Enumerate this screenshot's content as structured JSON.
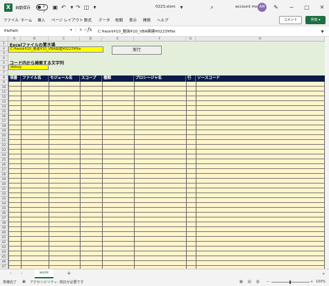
{
  "titlebar": {
    "autosave_label": "自動保存",
    "autosave_state": "オフ",
    "file_title": "0223.xlsm",
    "account": "account ms",
    "avatar_initials": "AM"
  },
  "menu": {
    "items": [
      "ファイル",
      "ホーム",
      "挿入",
      "ページ レイアウト",
      "数式",
      "データ",
      "校閲",
      "表示",
      "開発",
      "ヘルプ"
    ],
    "comment_label": "コメント",
    "share_label": "共有"
  },
  "formula_bar": {
    "name_box": "filePath",
    "fx": "fx",
    "formula": "C:¥work¥10_勉強¥10_VBA関連¥0223¥file"
  },
  "grid": {
    "columns": [
      "A",
      "B",
      "C",
      "D",
      "E",
      "F",
      "G",
      "H"
    ],
    "rows": [
      "1",
      "2",
      "3",
      "4",
      "5",
      "6",
      "7",
      "8",
      "9",
      "10",
      "11",
      "12",
      "13",
      "14",
      "15",
      "16",
      "17",
      "18",
      "19",
      "20",
      "21",
      "22",
      "23",
      "24",
      "25",
      "26",
      "27",
      "28",
      "29",
      "30",
      "31",
      "32",
      "33",
      "34",
      "35",
      "36",
      "37",
      "38",
      "39",
      "40",
      "41",
      "42",
      "43",
      "44",
      "45",
      "46",
      "47"
    ]
  },
  "sheet": {
    "excel_file_label": "Excelファイルの置き場",
    "file_path": "C:¥work¥10_勉強¥10_VBA関連¥0223¥file",
    "run_button": "実行",
    "search_label": "コード内から検索する文字列",
    "search_value": "debug",
    "headers": [
      "項番",
      "ファイル名",
      "モジュール名",
      "スコープ",
      "種類",
      "プロシージャ名",
      "行",
      "ソースコード"
    ]
  },
  "tabs": {
    "sheet_name": "work",
    "add": "+"
  },
  "status": {
    "ready": "準備完了",
    "accessibility": "アクセシビリティ: 検討が必要です",
    "zoom": "100%"
  },
  "colors": {
    "excel_green": "#1d6f42",
    "header_navy": "#0d1b4a",
    "body_cream": "#fff5cc",
    "input_yellow": "#ffff00",
    "sheet_green": "#e3efda"
  }
}
